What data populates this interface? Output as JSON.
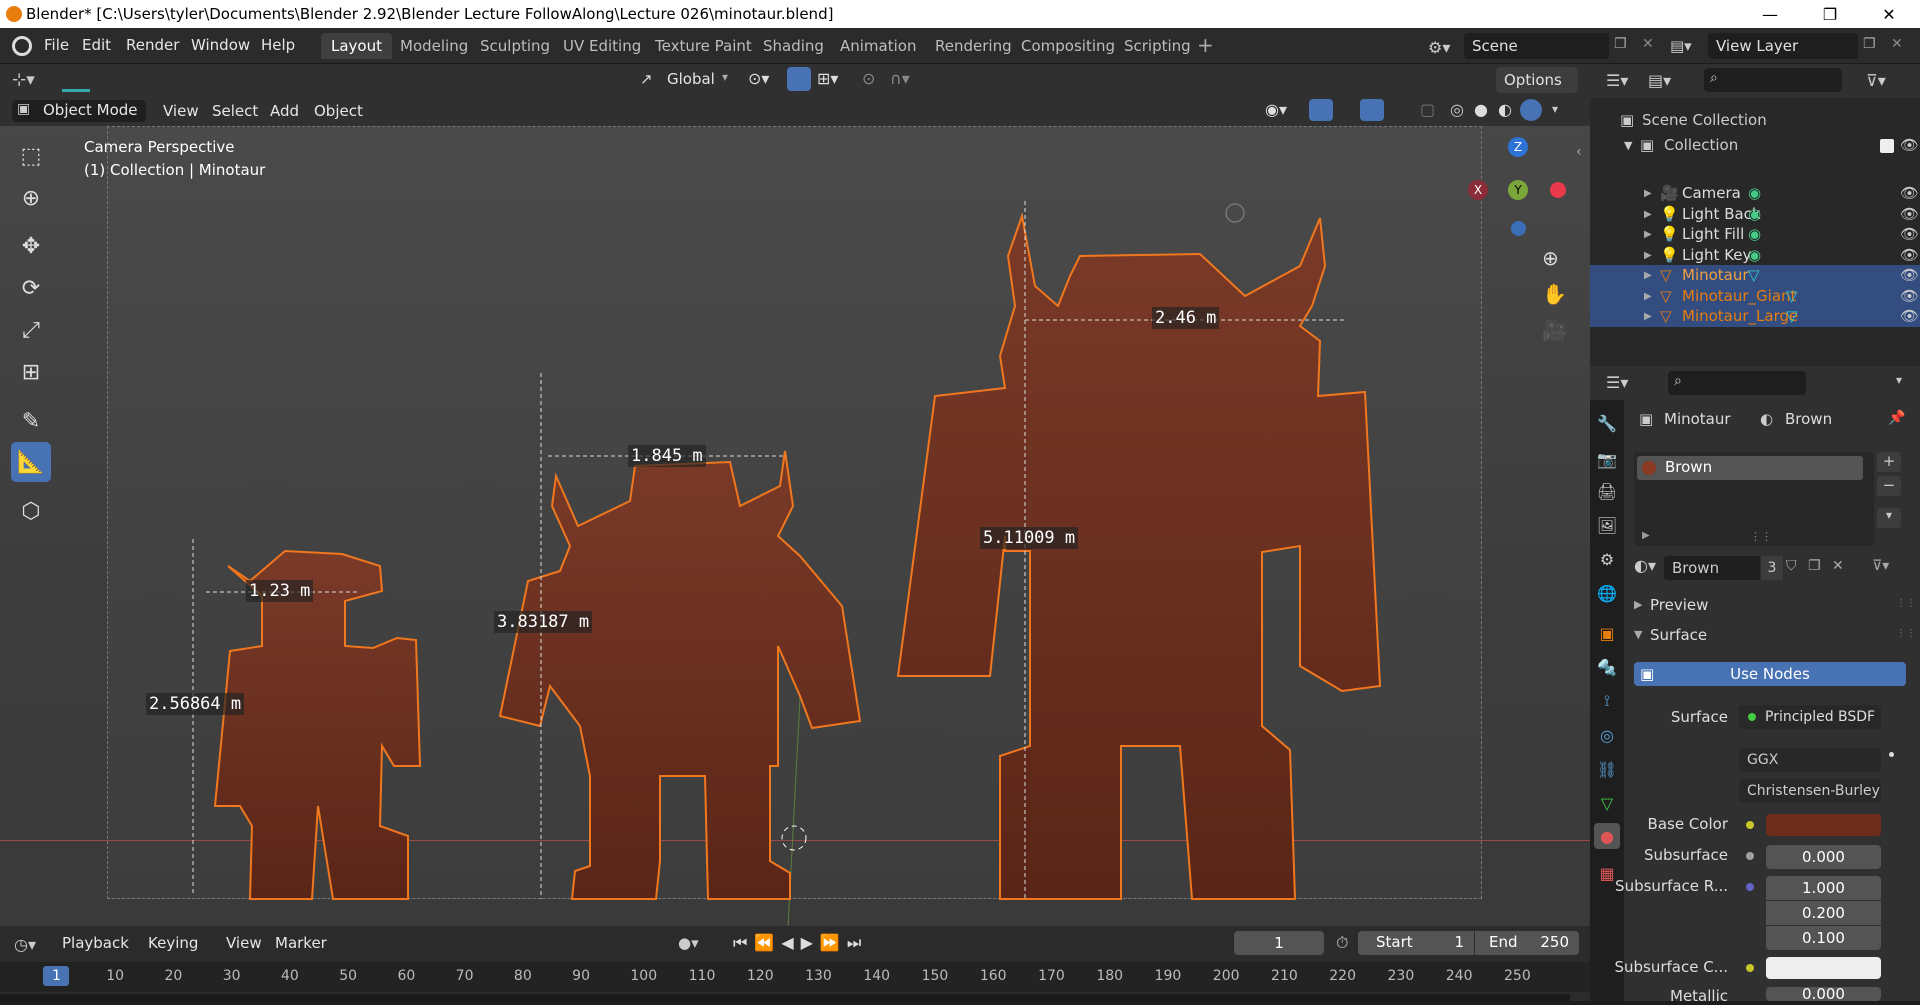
{
  "window": {
    "title": "Blender* [C:\\Users\\tyler\\Documents\\Blender 2.92\\Blender Lecture FollowAlong\\Lecture 026\\minotaur.blend]",
    "minimize": "—",
    "maximize": "❐",
    "close": "✕"
  },
  "menu": [
    "File",
    "Edit",
    "Render",
    "Window",
    "Help"
  ],
  "workspaces": [
    "Layout",
    "Modeling",
    "Sculpting",
    "UV Editing",
    "Texture Paint",
    "Shading",
    "Animation",
    "Rendering",
    "Compositing",
    "Scripting"
  ],
  "active_workspace": "Layout",
  "scene": {
    "scene_name": "Scene",
    "view_layer": "View Layer"
  },
  "viewport_header": {
    "transform_orientation": "Global",
    "options": "Options",
    "mode": "Object Mode",
    "menus": [
      "View",
      "Select",
      "Add",
      "Object"
    ]
  },
  "viewport": {
    "camera_label": "Camera Perspective",
    "collection_label": "(1) Collection | Minotaur",
    "measurements": {
      "small_width": "1.23 m",
      "small_height": "2.56864 m",
      "medium_width": "1.845 m",
      "medium_height": "3.83187 m",
      "large_width": "2.46 m",
      "large_height": "5.11009 m"
    },
    "gizmo": {
      "z": "Z",
      "y": "Y",
      "x": "X"
    }
  },
  "outliner": {
    "root": "Scene Collection",
    "collection": "Collection",
    "items": [
      {
        "name": "Camera",
        "selected": false
      },
      {
        "name": "Light Back",
        "selected": false
      },
      {
        "name": "Light Fill",
        "selected": false
      },
      {
        "name": "Light Key",
        "selected": false
      },
      {
        "name": "Minotaur",
        "selected": true
      },
      {
        "name": "Minotaur_Giant",
        "selected": true
      },
      {
        "name": "Minotaur_Large",
        "selected": true
      }
    ]
  },
  "properties": {
    "breadcrumb_object": "Minotaur",
    "breadcrumb_material": "Brown",
    "slot": "Brown",
    "material_name": "Brown",
    "users": "3",
    "preview": "Preview",
    "surface_panel": "Surface",
    "use_nodes": "Use Nodes",
    "surface_label": "Surface",
    "surface_value": "Principled BSDF",
    "distribution": "GGX",
    "subsurface_method": "Christensen-Burley",
    "base_color_label": "Base Color",
    "base_color": "#6e2d1c",
    "subsurface_label": "Subsurface",
    "subsurface_value": "0.000",
    "subsurface_radius_label": "Subsurface R...",
    "radius": [
      "1.000",
      "0.200",
      "0.100"
    ],
    "subsurface_color_label": "Subsurface C...",
    "metallic_label": "Metallic",
    "metallic_value": "0.000"
  },
  "timeline": {
    "menus": [
      "Playback",
      "Keying",
      "View",
      "Marker"
    ],
    "current_frame": "1",
    "start_label": "Start",
    "start": "1",
    "end_label": "End",
    "end": "250",
    "ticks": [
      "1",
      "10",
      "20",
      "30",
      "40",
      "50",
      "60",
      "70",
      "80",
      "90",
      "100",
      "110",
      "120",
      "130",
      "140",
      "150",
      "160",
      "170",
      "180",
      "190",
      "200",
      "210",
      "220",
      "230",
      "240",
      "250"
    ]
  },
  "colors": {
    "accent": "#4772b3",
    "selection": "#334d80",
    "minotaur_body": "#6e2d1c",
    "outline": "#f0771e"
  }
}
